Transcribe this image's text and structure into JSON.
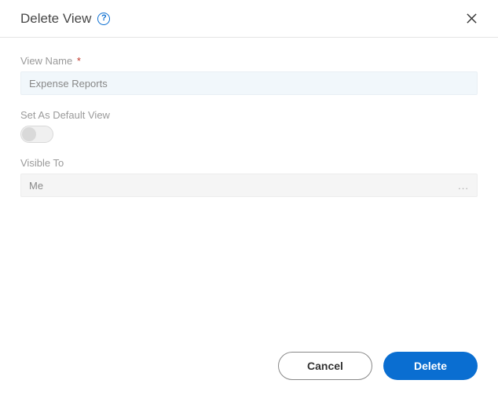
{
  "header": {
    "title": "Delete View",
    "help_glyph": "?"
  },
  "fields": {
    "view_name": {
      "label": "View Name",
      "value": "Expense Reports",
      "required_mark": "*"
    },
    "default_view": {
      "label": "Set As Default View",
      "enabled": false
    },
    "visible_to": {
      "label": "Visible To",
      "value": "Me",
      "more": "..."
    }
  },
  "footer": {
    "cancel_label": "Cancel",
    "delete_label": "Delete"
  }
}
